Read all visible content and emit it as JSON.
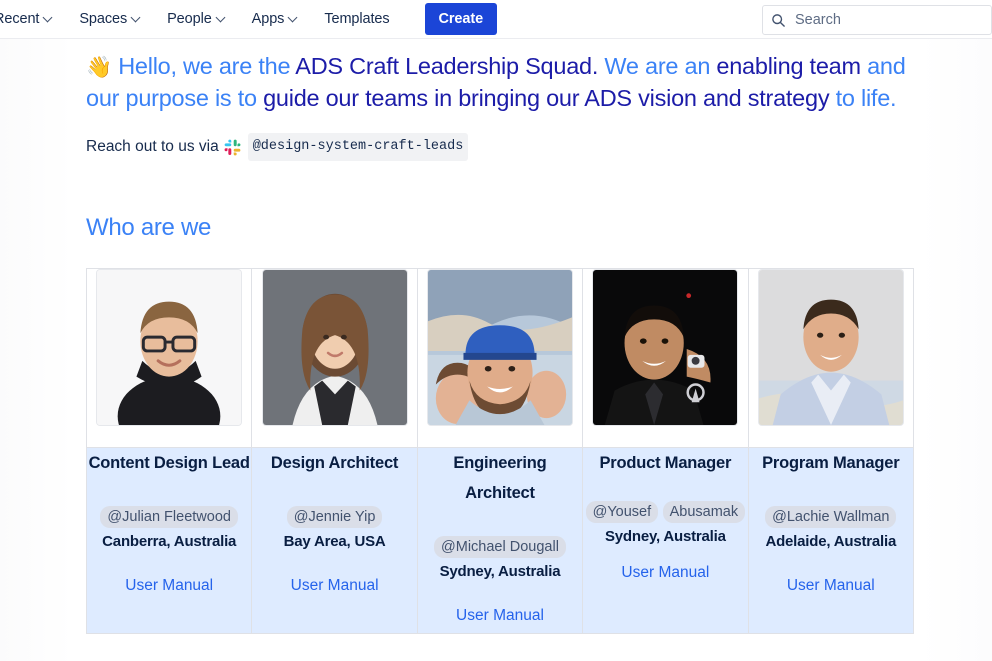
{
  "nav": {
    "items": [
      {
        "label": "Recent",
        "has_chevron": true,
        "icon": "chevron-down-icon"
      },
      {
        "label": "Spaces",
        "has_chevron": true,
        "icon": "chevron-down-icon"
      },
      {
        "label": "People",
        "has_chevron": true,
        "icon": "chevron-down-icon"
      },
      {
        "label": "Apps",
        "has_chevron": true,
        "icon": "chevron-down-icon"
      },
      {
        "label": "Templates",
        "has_chevron": false,
        "icon": ""
      }
    ],
    "create_label": "Create",
    "create_color": "#1b45d7",
    "search": {
      "placeholder": "Search",
      "value": "",
      "icon": "search-icon"
    }
  },
  "intro": {
    "emoji": "👋",
    "emoji_name": "waving-hand-emoji",
    "segments": [
      {
        "text": "Hello, we are the ",
        "color": "blue"
      },
      {
        "text": "ADS Craft Leadership Squad.",
        "color": "navy"
      },
      {
        "text": " We are an ",
        "color": "blue"
      },
      {
        "text": "enabling team",
        "color": "navy"
      },
      {
        "text": " and our purpose is to ",
        "color": "blue"
      },
      {
        "text": "guide our teams in bringing our ADS vision and strategy",
        "color": "navy"
      },
      {
        "text": " to life.",
        "color": "blue"
      }
    ],
    "full_text": "👋 Hello, we are the ADS Craft Leadership Squad. We are an enabling team and our purpose is to guide our teams in bringing our ADS vision and strategy to life.",
    "blue_hex": "#3b82f6",
    "navy_hex": "#1c1ca8"
  },
  "reach_out": {
    "prefix": "Reach out to us via",
    "slack_icon": "slack-logo-icon",
    "channel": "@design-system-craft-leads"
  },
  "section": {
    "title": "Who are we"
  },
  "team": {
    "members": [
      {
        "role": "Content Design Lead",
        "mention": "@Julian Fleetwood",
        "location": "Canberra, Australia",
        "link_label": "User Manual",
        "photo": "portrait-man-glasses-black-shirt"
      },
      {
        "role": "Design Architect",
        "mention": "@Jennie Yip",
        "location": "Bay Area, USA",
        "link_label": "User Manual",
        "photo": "portrait-woman-long-hair-grey-background"
      },
      {
        "role": "Engineering Architect",
        "mention": "@Michael Dougall",
        "location": "Sydney, Australia",
        "link_label": "User Manual",
        "photo": "portrait-man-cap-beard-outdoors-group"
      },
      {
        "role": "Product Manager",
        "mention": "@Yousef Abusamak",
        "mention_line1": "@Yousef",
        "mention_line2": "Abusamak",
        "location": "Sydney, Australia",
        "link_label": "User Manual",
        "photo": "portrait-man-suit-dark-background"
      },
      {
        "role": "Program Manager",
        "mention": "@Lachie Wallman",
        "location": "Adelaide, Australia",
        "link_label": "User Manual",
        "photo": "portrait-man-light-blue-shirt-beach"
      }
    ],
    "row_background": "#deebff",
    "link_color": "#2563eb"
  }
}
